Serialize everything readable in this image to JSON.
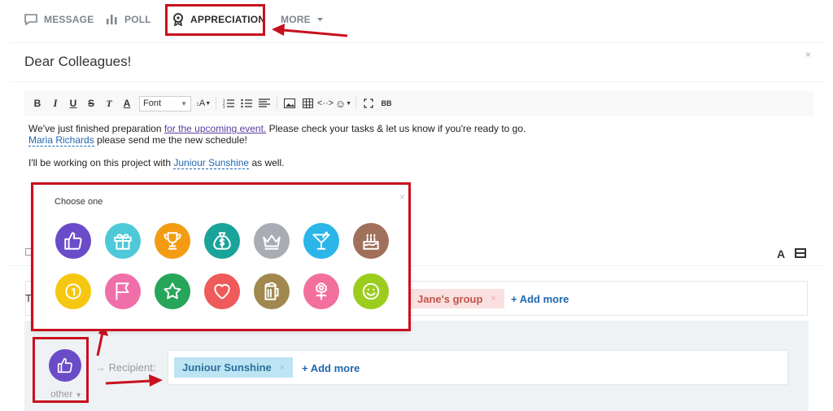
{
  "tabs": [
    {
      "label": "MESSAGE",
      "icon": "message-icon"
    },
    {
      "label": "POLL",
      "icon": "poll-icon"
    },
    {
      "label": "APPRECIATION",
      "icon": "award-icon",
      "active": true
    },
    {
      "label": "MORE",
      "icon": "chevron-down-icon"
    }
  ],
  "post": {
    "title": "Dear Colleagues!",
    "close": "×"
  },
  "toolbar": {
    "bold": "B",
    "italic": "I",
    "underline": "U",
    "strike": "S",
    "clear": "T",
    "color": "A",
    "font": "Font",
    "size": "A"
  },
  "editor": {
    "line1_a": "We've just finished preparation ",
    "line1_link": "for the upcoming event.",
    "line1_b": " Please check your tasks & let us know if you're ready to go.",
    "line2_mention": "Maria Richards",
    "line2_b": " please send me the new schedule!",
    "line3_a": "I'll be working on this project with ",
    "line3_mention": "Juniour Sunshine",
    "line3_b": " as well."
  },
  "popup": {
    "title": "Choose one",
    "close": "×",
    "icons": [
      {
        "name": "thumbs-up-icon",
        "color": "#6a4cc8"
      },
      {
        "name": "gift-icon",
        "color": "#4ec9d8"
      },
      {
        "name": "trophy-icon",
        "color": "#f39c12"
      },
      {
        "name": "money-bag-icon",
        "color": "#1aa39a"
      },
      {
        "name": "crown-icon",
        "color": "#a8adb3"
      },
      {
        "name": "cocktail-icon",
        "color": "#2bb5e8"
      },
      {
        "name": "cake-icon",
        "color": "#a0705a"
      },
      {
        "name": "medal-icon",
        "color": "#f5c710"
      },
      {
        "name": "flag-icon",
        "color": "#f06fa8"
      },
      {
        "name": "star-icon",
        "color": "#27a55a"
      },
      {
        "name": "heart-icon",
        "color": "#ef5a5a"
      },
      {
        "name": "beer-icon",
        "color": "#a0884e"
      },
      {
        "name": "flower-icon",
        "color": "#f36f9e"
      },
      {
        "name": "smile-icon",
        "color": "#9ccd1d"
      }
    ]
  },
  "recipients": {
    "to_label": "T",
    "group_tag": "Jane's group",
    "tag_remove": "×",
    "add_more": "+ Add more",
    "badge_label": "other",
    "recipient_label": "Recipient:",
    "recipient_tag": "Juniour Sunshine",
    "recipient_add_more": "+ Add more"
  },
  "format_label": "A"
}
